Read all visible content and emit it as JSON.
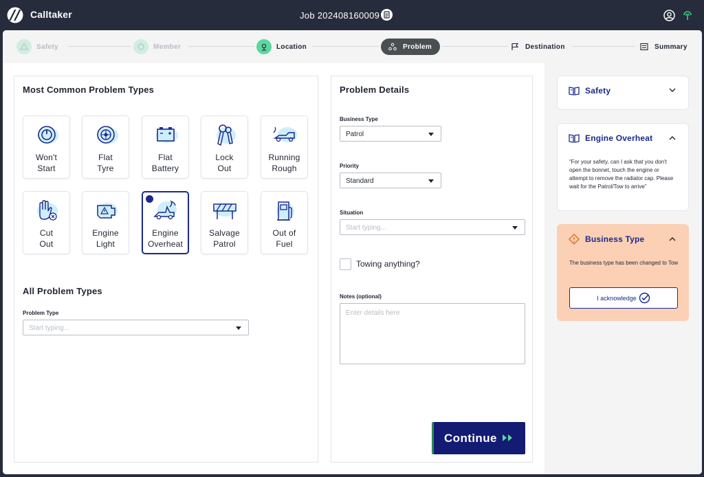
{
  "app": {
    "title": "Calltaker"
  },
  "header": {
    "job_title": "Job 202408160009"
  },
  "stepper": {
    "steps": [
      {
        "label": "Safety",
        "state": "done"
      },
      {
        "label": "Member",
        "state": "done"
      },
      {
        "label": "Location",
        "state": "active"
      },
      {
        "label": "Problem",
        "state": "current"
      },
      {
        "label": "Destination",
        "state": "future"
      },
      {
        "label": "Summary",
        "state": "future"
      }
    ]
  },
  "common_types": {
    "title": "Most Common Problem Types",
    "tiles": [
      {
        "line1": "Won't",
        "line2": "Start",
        "icon": "power-icon"
      },
      {
        "line1": "Flat",
        "line2": "Tyre",
        "icon": "tyre-icon"
      },
      {
        "line1": "Flat",
        "line2": "Battery",
        "icon": "battery-icon"
      },
      {
        "line1": "Lock",
        "line2": "Out",
        "icon": "keys-icon"
      },
      {
        "line1": "Running",
        "line2": "Rough",
        "icon": "rough-engine-icon"
      },
      {
        "line1": "Cut",
        "line2": "Out",
        "icon": "hand-stop-icon"
      },
      {
        "line1": "Engine",
        "line2": "Light",
        "icon": "engine-light-icon"
      },
      {
        "line1": "Engine",
        "line2": "Overheat",
        "icon": "overheat-car-icon",
        "selected": true
      },
      {
        "line1": "Salvage",
        "line2": "Patrol",
        "icon": "barrier-icon"
      },
      {
        "line1": "Out of",
        "line2": "Fuel",
        "icon": "fuel-pump-icon"
      }
    ]
  },
  "all_types": {
    "title": "All Problem Types",
    "field_label": "Problem Type",
    "placeholder": "Start typing..."
  },
  "details": {
    "title": "Problem Details",
    "business_type": {
      "label": "Business Type",
      "value": "Patrol"
    },
    "priority": {
      "label": "Priority",
      "value": "Standard"
    },
    "situation": {
      "label": "Situation",
      "placeholder": "Start typing..."
    },
    "towing": {
      "label": "Towing anything?",
      "checked": false
    },
    "notes": {
      "label": "Notes (optional)",
      "placeholder": "Enter details here"
    },
    "continue_label": "Continue"
  },
  "sidebar": {
    "safety": {
      "title": "Safety"
    },
    "overheat": {
      "title": "Engine Overheat",
      "text": "“For your safety, can I ask that you don't open the bonnet, touch the engine or attempt to remove the radiator cap. Please wait for the Patrol/Tow to arrive”"
    },
    "business": {
      "title": "Business Type",
      "text": "The business type has been changed to Tow",
      "button": "I acknowledge"
    }
  },
  "colors": {
    "brand_navy": "#131b73",
    "accent_green": "#5cd6a0",
    "warning_bg": "#fbd0b5",
    "header_bg": "#262c3b"
  }
}
